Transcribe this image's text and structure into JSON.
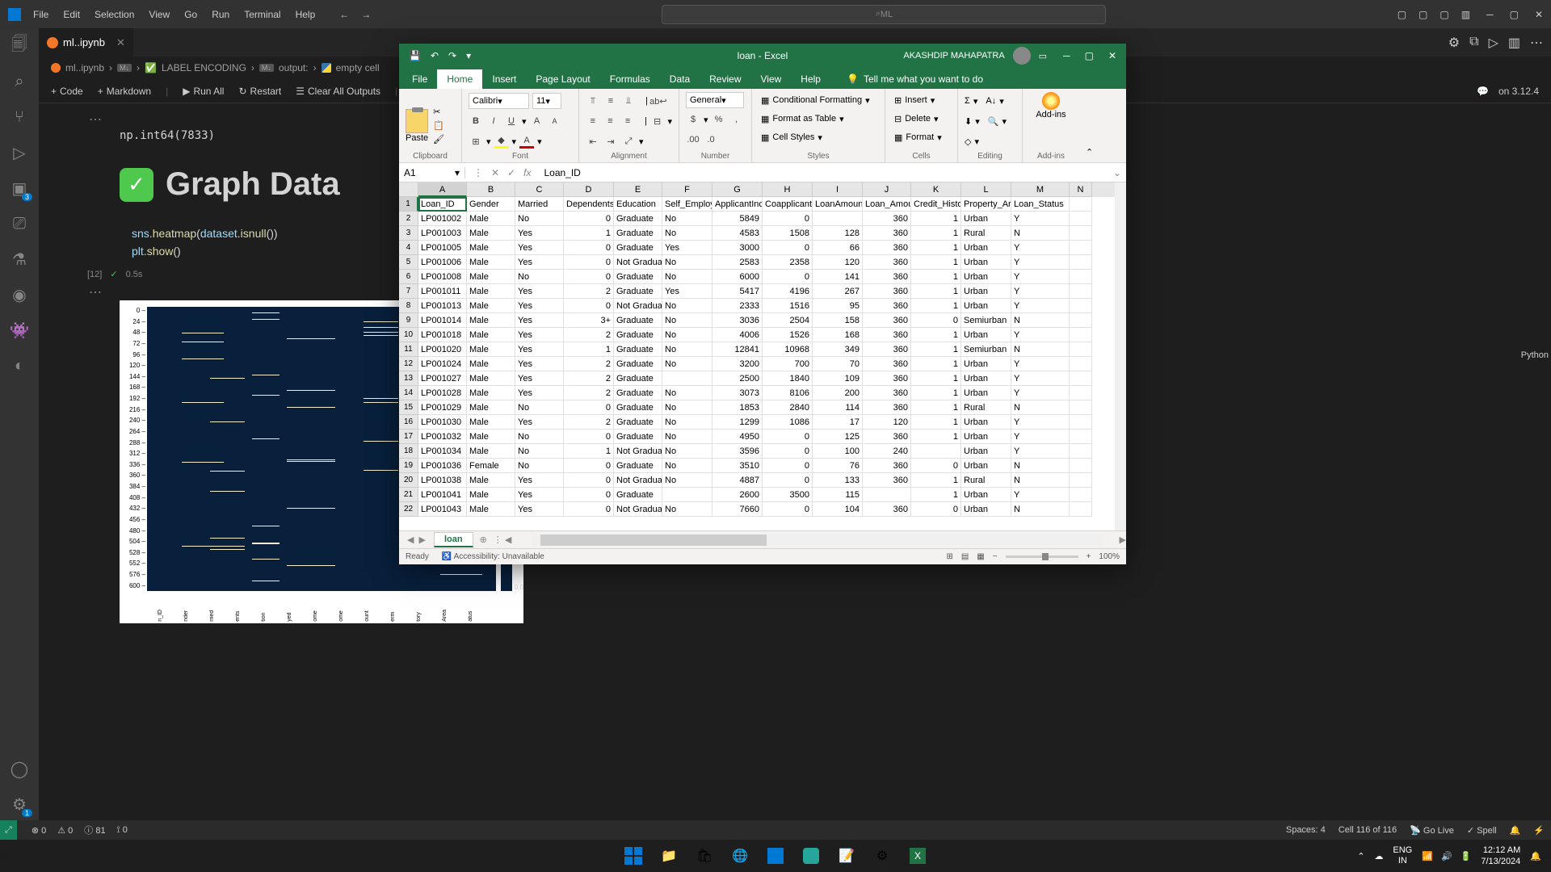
{
  "vscode": {
    "menu": [
      "File",
      "Edit",
      "Selection",
      "View",
      "Go",
      "Run",
      "Terminal",
      "Help"
    ],
    "search_text": "ML",
    "tab_name": "ml..ipynb",
    "breadcrumb": {
      "file": "ml..ipynb",
      "cell1": "LABEL ENCODING",
      "output": "output:",
      "cell2": "empty cell"
    },
    "toolbar": {
      "code": "Code",
      "markdown": "Markdown",
      "runall": "Run All",
      "restart": "Restart",
      "clear": "Clear All Outputs",
      "kernel": "on 3.12.4"
    },
    "output_line": "np.int64(7833)",
    "md_title": "Graph Data",
    "code_lines": {
      "l1_a": "sns",
      "l1_b": "heatmap",
      "l1_c": "dataset",
      "l1_d": "isnull",
      "l2_a": "plt",
      "l2_b": "show"
    },
    "exec_count": "[12]",
    "exec_time": "0.5s",
    "heatmap_yticks": [
      "0",
      "24",
      "48",
      "72",
      "96",
      "120",
      "144",
      "168",
      "192",
      "216",
      "240",
      "264",
      "288",
      "312",
      "336",
      "360",
      "384",
      "408",
      "432",
      "456",
      "480",
      "504",
      "528",
      "552",
      "576",
      "600"
    ],
    "heatmap_xticks": [
      "n_ID",
      "nder",
      "rried",
      "ents",
      "tion",
      "yed",
      "ome",
      "ome",
      "ount",
      "erm",
      "tory",
      "Area",
      "atus"
    ],
    "heatmap_cbar": "0.0",
    "status": {
      "errors": "0",
      "warnings": "0",
      "info": "81",
      "ports": "0",
      "spaces": "Spaces: 4",
      "cell": "Cell 116 of 116",
      "golive": "Go Live",
      "spell": "Spell"
    },
    "lang_mode": "Python",
    "sidebar_badges": {
      "ext": "3",
      "settings": "1"
    }
  },
  "excel": {
    "title": "loan  -  Excel",
    "user": "AKASHDIP MAHAPATRA",
    "tabs": [
      "File",
      "Home",
      "Insert",
      "Page Layout",
      "Formulas",
      "Data",
      "Review",
      "View",
      "Help"
    ],
    "tell_me": "Tell me what you want to do",
    "ribbon": {
      "paste": "Paste",
      "font_name": "Calibri",
      "font_size": "11",
      "number_format": "General",
      "cond_fmt": "Conditional Formatting",
      "fmt_table": "Format as Table",
      "cell_styles": "Cell Styles",
      "insert": "Insert",
      "delete": "Delete",
      "format": "Format",
      "addins": "Add-ins",
      "groups": {
        "clipboard": "Clipboard",
        "font": "Font",
        "alignment": "Alignment",
        "number": "Number",
        "styles": "Styles",
        "cells": "Cells",
        "editing": "Editing",
        "addins": "Add-ins"
      }
    },
    "name_box": "A1",
    "formula_value": "Loan_ID",
    "columns": [
      "A",
      "B",
      "C",
      "D",
      "E",
      "F",
      "G",
      "H",
      "I",
      "J",
      "K",
      "L",
      "M",
      "N"
    ],
    "headers": [
      "Loan_ID",
      "Gender",
      "Married",
      "Dependents",
      "Education",
      "Self_Employed",
      "ApplicantIncome",
      "CoapplicantIncome",
      "LoanAmount",
      "Loan_Amount_Term",
      "Credit_History",
      "Property_Area",
      "Loan_Status"
    ],
    "rows": [
      [
        "LP001002",
        "Male",
        "No",
        "0",
        "Graduate",
        "No",
        "5849",
        "0",
        "",
        "360",
        "1",
        "Urban",
        "Y"
      ],
      [
        "LP001003",
        "Male",
        "Yes",
        "1",
        "Graduate",
        "No",
        "4583",
        "1508",
        "128",
        "360",
        "1",
        "Rural",
        "N"
      ],
      [
        "LP001005",
        "Male",
        "Yes",
        "0",
        "Graduate",
        "Yes",
        "3000",
        "0",
        "66",
        "360",
        "1",
        "Urban",
        "Y"
      ],
      [
        "LP001006",
        "Male",
        "Yes",
        "0",
        "Not Graduate",
        "No",
        "2583",
        "2358",
        "120",
        "360",
        "1",
        "Urban",
        "Y"
      ],
      [
        "LP001008",
        "Male",
        "No",
        "0",
        "Graduate",
        "No",
        "6000",
        "0",
        "141",
        "360",
        "1",
        "Urban",
        "Y"
      ],
      [
        "LP001011",
        "Male",
        "Yes",
        "2",
        "Graduate",
        "Yes",
        "5417",
        "4196",
        "267",
        "360",
        "1",
        "Urban",
        "Y"
      ],
      [
        "LP001013",
        "Male",
        "Yes",
        "0",
        "Not Graduate",
        "No",
        "2333",
        "1516",
        "95",
        "360",
        "1",
        "Urban",
        "Y"
      ],
      [
        "LP001014",
        "Male",
        "Yes",
        "3+",
        "Graduate",
        "No",
        "3036",
        "2504",
        "158",
        "360",
        "0",
        "Semiurban",
        "N"
      ],
      [
        "LP001018",
        "Male",
        "Yes",
        "2",
        "Graduate",
        "No",
        "4006",
        "1526",
        "168",
        "360",
        "1",
        "Urban",
        "Y"
      ],
      [
        "LP001020",
        "Male",
        "Yes",
        "1",
        "Graduate",
        "No",
        "12841",
        "10968",
        "349",
        "360",
        "1",
        "Semiurban",
        "N"
      ],
      [
        "LP001024",
        "Male",
        "Yes",
        "2",
        "Graduate",
        "No",
        "3200",
        "700",
        "70",
        "360",
        "1",
        "Urban",
        "Y"
      ],
      [
        "LP001027",
        "Male",
        "Yes",
        "2",
        "Graduate",
        "",
        "2500",
        "1840",
        "109",
        "360",
        "1",
        "Urban",
        "Y"
      ],
      [
        "LP001028",
        "Male",
        "Yes",
        "2",
        "Graduate",
        "No",
        "3073",
        "8106",
        "200",
        "360",
        "1",
        "Urban",
        "Y"
      ],
      [
        "LP001029",
        "Male",
        "No",
        "0",
        "Graduate",
        "No",
        "1853",
        "2840",
        "114",
        "360",
        "1",
        "Rural",
        "N"
      ],
      [
        "LP001030",
        "Male",
        "Yes",
        "2",
        "Graduate",
        "No",
        "1299",
        "1086",
        "17",
        "120",
        "1",
        "Urban",
        "Y"
      ],
      [
        "LP001032",
        "Male",
        "No",
        "0",
        "Graduate",
        "No",
        "4950",
        "0",
        "125",
        "360",
        "1",
        "Urban",
        "Y"
      ],
      [
        "LP001034",
        "Male",
        "No",
        "1",
        "Not Graduate",
        "No",
        "3596",
        "0",
        "100",
        "240",
        "",
        "Urban",
        "Y"
      ],
      [
        "LP001036",
        "Female",
        "No",
        "0",
        "Graduate",
        "No",
        "3510",
        "0",
        "76",
        "360",
        "0",
        "Urban",
        "N"
      ],
      [
        "LP001038",
        "Male",
        "Yes",
        "0",
        "Not Graduate",
        "No",
        "4887",
        "0",
        "133",
        "360",
        "1",
        "Rural",
        "N"
      ],
      [
        "LP001041",
        "Male",
        "Yes",
        "0",
        "Graduate",
        "",
        "2600",
        "3500",
        "115",
        "",
        "1",
        "Urban",
        "Y"
      ],
      [
        "LP001043",
        "Male",
        "Yes",
        "0",
        "Not Graduate",
        "No",
        "7660",
        "0",
        "104",
        "360",
        "0",
        "Urban",
        "N"
      ]
    ],
    "sheet_name": "loan",
    "status_ready": "Ready",
    "accessibility": "Accessibility: Unavailable",
    "zoom": "100%"
  },
  "taskbar": {
    "lang": {
      "top": "ENG",
      "bottom": "IN"
    },
    "clock": {
      "time": "12:12 AM",
      "date": "7/13/2024"
    }
  },
  "chart_data": {
    "type": "heatmap",
    "title": "",
    "xlabel": "",
    "ylabel": "",
    "x_categories": [
      "Loan_ID",
      "Gender",
      "Married",
      "Dependents",
      "Education",
      "Self_Employed",
      "ApplicantIncome",
      "CoapplicantIncome",
      "LoanAmount",
      "Loan_Amount_Term",
      "Credit_History",
      "Property_Area",
      "Loan_Status"
    ],
    "y_range": [
      0,
      614
    ],
    "colorbar_range": [
      0.0,
      0.0
    ],
    "note": "heatmap of dataset.isnull(); bright stripes indicate rows with NaN in Self_Employed, LoanAmount, Loan_Amount_Term, Credit_History columns"
  }
}
